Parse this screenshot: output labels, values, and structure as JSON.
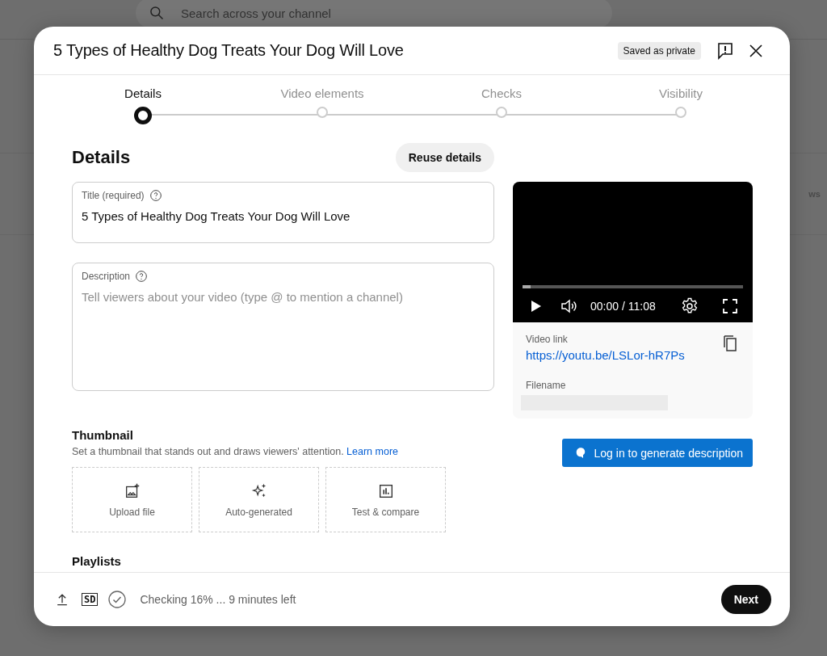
{
  "background": {
    "search": {
      "placeholder": "Search across your channel"
    },
    "column_fragment": "ws"
  },
  "dialog": {
    "title": "5 Types of Healthy Dog Treats Your Dog Will Love",
    "status_badge": "Saved as private"
  },
  "steps": [
    {
      "label": "Details",
      "selected": true
    },
    {
      "label": "Video elements",
      "selected": false
    },
    {
      "label": "Checks",
      "selected": false
    },
    {
      "label": "Visibility",
      "selected": false
    }
  ],
  "details": {
    "heading": "Details",
    "reuse_button": "Reuse details",
    "title_field": {
      "label": "Title (required)",
      "value": "5 Types of Healthy Dog Treats Your Dog Will Love"
    },
    "description_field": {
      "label": "Description",
      "placeholder": "Tell viewers about your video (type @ to mention a channel)"
    }
  },
  "thumbnail": {
    "heading": "Thumbnail",
    "description": "Set a thumbnail that stands out and draws viewers' attention.",
    "link": "Learn more",
    "options": [
      {
        "kind": "upload",
        "label": "Upload file"
      },
      {
        "kind": "auto",
        "label": "Auto-generated"
      },
      {
        "kind": "test",
        "label": "Test & compare"
      }
    ]
  },
  "playlists": {
    "heading": "Playlists"
  },
  "player": {
    "level": 0.035,
    "time": "00:00 / 11:08"
  },
  "video_info": {
    "link_label": "Video link",
    "link": "https://youtu.be/LSLor-hR7Ps",
    "filename_label": "Filename"
  },
  "generate_button": "Log in to generate description",
  "footer": {
    "quality_badge": "SD",
    "status": "Checking 16% ... 9 minutes left",
    "next_button": "Next"
  }
}
